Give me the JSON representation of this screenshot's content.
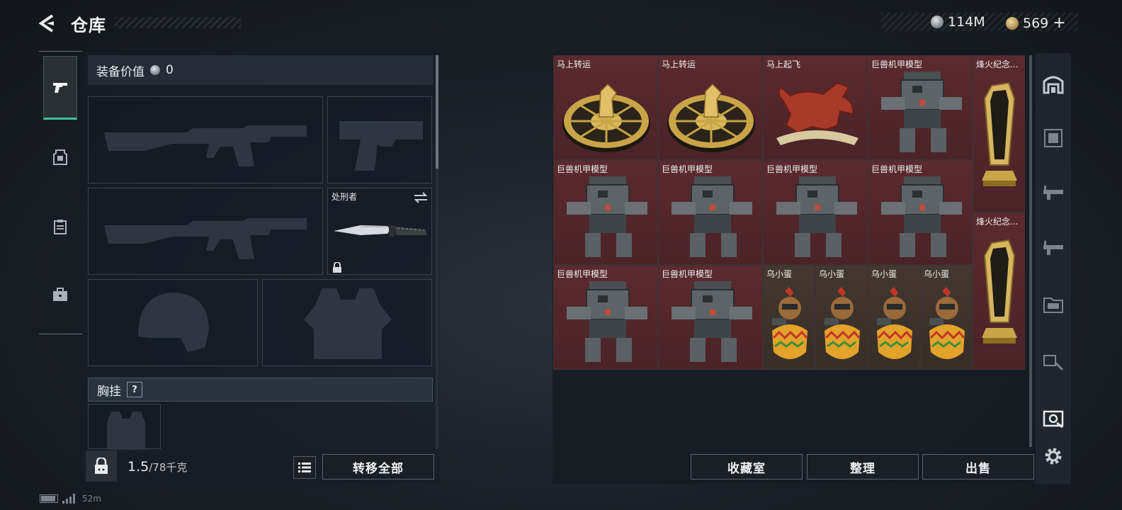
{
  "header": {
    "title": "仓库",
    "currencies": [
      {
        "icon": "silver-coin-icon",
        "value": "114M"
      },
      {
        "icon": "gold-coin-icon",
        "value": "569"
      }
    ],
    "add_label": "+"
  },
  "left_tabs": [
    {
      "name": "weapons",
      "icon": "pistol-icon",
      "active": true
    },
    {
      "name": "armor",
      "icon": "armor-icon"
    },
    {
      "name": "clipboard",
      "icon": "clipboard-icon"
    },
    {
      "name": "case",
      "icon": "briefcase-icon"
    }
  ],
  "equipment": {
    "value_label": "装备价值",
    "value": "0",
    "melee_label": "处刑者",
    "chest_rig_label": "胸挂",
    "help_label": "?"
  },
  "weight": {
    "current": "1.5",
    "max": "/78千克"
  },
  "buttons": {
    "transfer_all": "转移全部",
    "collection": "收藏室",
    "sort": "整理",
    "sell": "出售"
  },
  "items": [
    {
      "label": "马上转运",
      "kind": "coin-wheel"
    },
    {
      "label": "马上转运",
      "kind": "coin-wheel"
    },
    {
      "label": "马上起飞",
      "kind": "horse"
    },
    {
      "label": "巨兽机甲模型",
      "kind": "mech"
    },
    {
      "label": "烽火纪念...",
      "kind": "trophy"
    },
    {
      "label": "巨兽机甲模型",
      "kind": "mech"
    },
    {
      "label": "巨兽机甲模型",
      "kind": "mech"
    },
    {
      "label": "巨兽机甲模型",
      "kind": "mech"
    },
    {
      "label": "巨兽机甲模型",
      "kind": "mech"
    },
    {
      "label": "烽火纪念...",
      "kind": "trophy"
    },
    {
      "label": "巨兽机甲模型",
      "kind": "mech"
    },
    {
      "label": "巨兽机甲模型",
      "kind": "mech"
    },
    {
      "label": "乌小蛋",
      "kind": "egg"
    },
    {
      "label": "乌小蛋",
      "kind": "egg"
    },
    {
      "label": "乌小蛋",
      "kind": "egg"
    },
    {
      "label": "乌小蛋",
      "kind": "egg"
    }
  ],
  "status_bar": {
    "signal_text": "52m"
  }
}
